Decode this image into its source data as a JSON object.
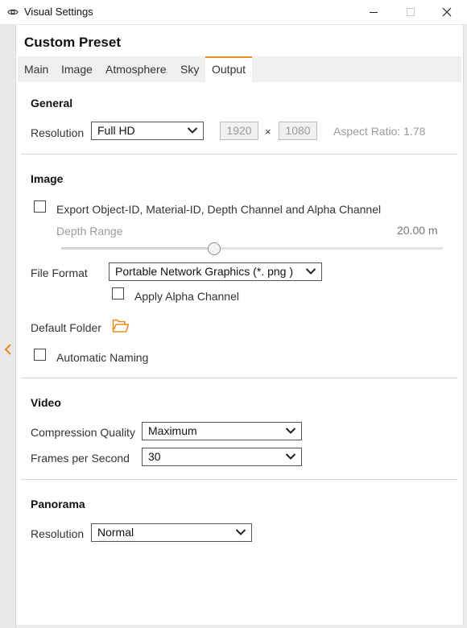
{
  "window": {
    "title": "Visual Settings",
    "app_icon": "eye-icon"
  },
  "preset_title": "Custom Preset",
  "tabs": [
    {
      "label": "Main",
      "active": false
    },
    {
      "label": "Image",
      "active": false
    },
    {
      "label": "Atmosphere",
      "active": false
    },
    {
      "label": "Sky",
      "active": false
    },
    {
      "label": "Output",
      "active": true
    }
  ],
  "general": {
    "heading": "General",
    "resolution_label": "Resolution",
    "resolution_value": "Full HD",
    "width": "1920",
    "times": "×",
    "height": "1080",
    "aspect_ratio": "Aspect Ratio: 1.78"
  },
  "image": {
    "heading": "Image",
    "export_channels_label": "Export Object-ID, Material-ID, Depth Channel and Alpha Channel",
    "export_channels_checked": false,
    "depth_range_label": "Depth Range",
    "depth_range_value": "20.00 m",
    "depth_slider_fraction": 0.4,
    "file_format_label": "File Format",
    "file_format_value": "Portable Network Graphics  (*. png )",
    "apply_alpha_label": "Apply Alpha Channel",
    "apply_alpha_checked": false,
    "default_folder_label": "Default Folder",
    "automatic_naming_label": "Automatic Naming",
    "automatic_naming_checked": false
  },
  "video": {
    "heading": "Video",
    "compression_label": "Compression Quality",
    "compression_value": "Maximum",
    "fps_label": "Frames per Second",
    "fps_value": "30"
  },
  "panorama": {
    "heading": "Panorama",
    "resolution_label": "Resolution",
    "resolution_value": "Normal"
  },
  "colors": {
    "accent": "#e88a1a",
    "folder": "#e88a1a"
  }
}
